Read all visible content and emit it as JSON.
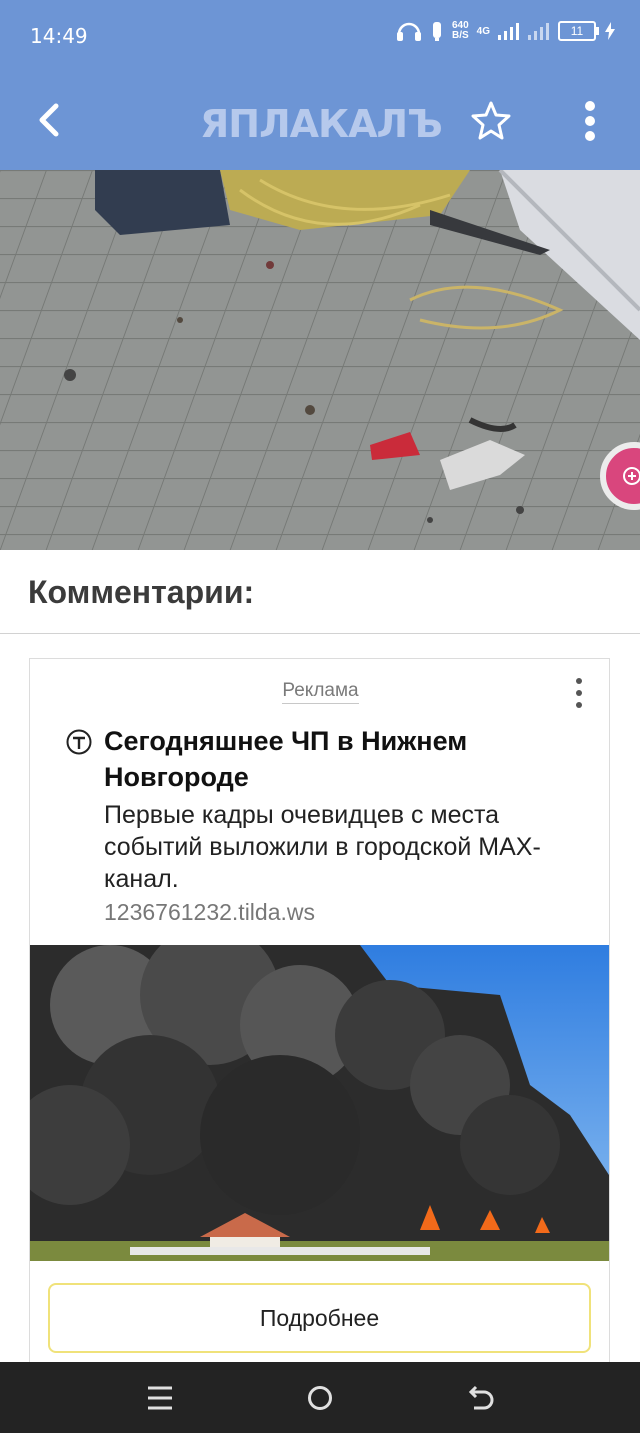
{
  "status_bar": {
    "time": "14:49",
    "net_speed_value": "640",
    "net_speed_unit": "B/S",
    "network": "4G",
    "battery": "11"
  },
  "app_bar": {
    "logo": "ЯПЛАКАЛЪ",
    "back_icon": "chevron-left-icon",
    "favorite_icon": "star-outline-icon",
    "menu_icon": "more-vertical-icon"
  },
  "content": {
    "comments_title": "Комментарии:"
  },
  "ad": {
    "label": "Реклама",
    "title": "Сегодняшнее ЧП в Нижнем Новгороде",
    "description": "Первые кадры очевидцев с места событий выложили в городской MAX-канал.",
    "domain": "1236761232.tilda.ws",
    "cta": "Подробнее"
  },
  "colors": {
    "app_bar": "#6d95d5",
    "zoom_button": "#d9467d",
    "cta_border": "#f0e27a",
    "nav_bar": "#232323"
  }
}
